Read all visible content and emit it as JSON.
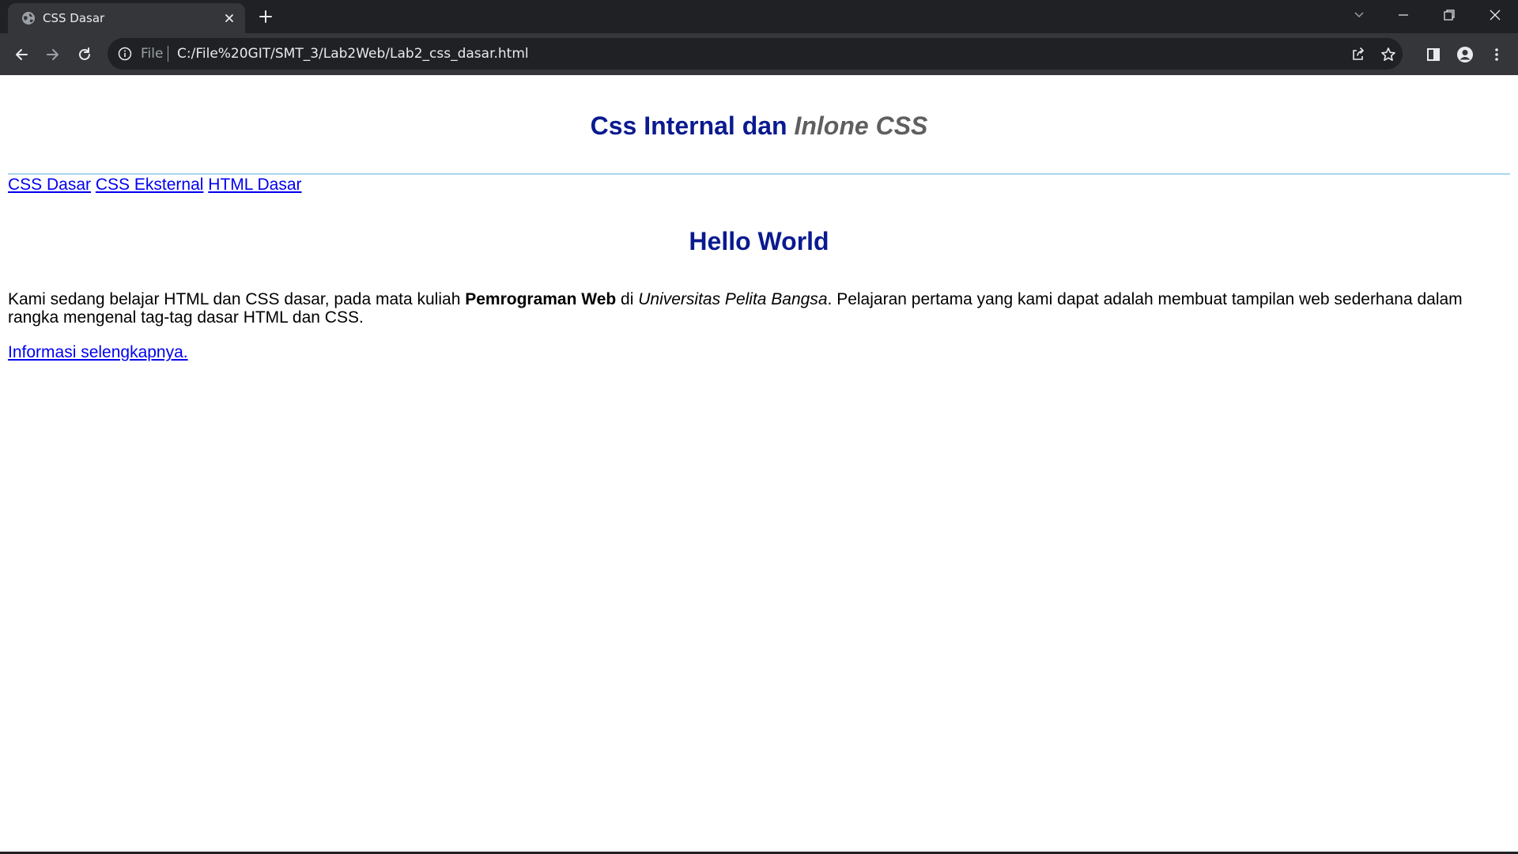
{
  "browser": {
    "tab_title": "CSS Dasar",
    "address_scheme": "File",
    "address_url": "C:/File%20GIT/SMT_3/Lab2Web/Lab2_css_dasar.html",
    "icons": [
      "globe-icon",
      "close-icon",
      "plus-icon",
      "chevron-down-icon",
      "minimize-icon",
      "restore-icon",
      "close-window-icon",
      "back-arrow-icon",
      "forward-arrow-icon",
      "reload-icon",
      "info-icon",
      "share-icon",
      "star-icon",
      "side-panel-icon",
      "profile-icon",
      "more-vert-icon"
    ],
    "colors": {
      "frame": "#202124",
      "toolbar": "#35363a",
      "text": "#e8eaed"
    }
  },
  "page": {
    "header": {
      "title_main": "Css Internal dan",
      "title_italic": "Inlone CSS"
    },
    "nav": {
      "links": [
        "CSS Dasar",
        "CSS Eksternal",
        "HTML Dasar"
      ]
    },
    "content": {
      "heading": "Hello World",
      "paragraph": {
        "part1": "Kami sedang belajar HTML dan CSS dasar, pada mata kuliah ",
        "bold": "Pemrograman Web",
        "part2": " di ",
        "italic": "Universitas Pelita Bangsa",
        "part3": ". Pelajaran pertama yang kami dapat adalah membuat tampilan web sederhana dalam rangka mengenal tag-tag dasar HTML dan CSS."
      },
      "more_link": "Informasi selengkapnya."
    },
    "colors": {
      "heading": "#0a1a8f",
      "italic_heading": "#5f5f5f",
      "link": "#0000ee",
      "rule": "#a9d6ee"
    }
  }
}
